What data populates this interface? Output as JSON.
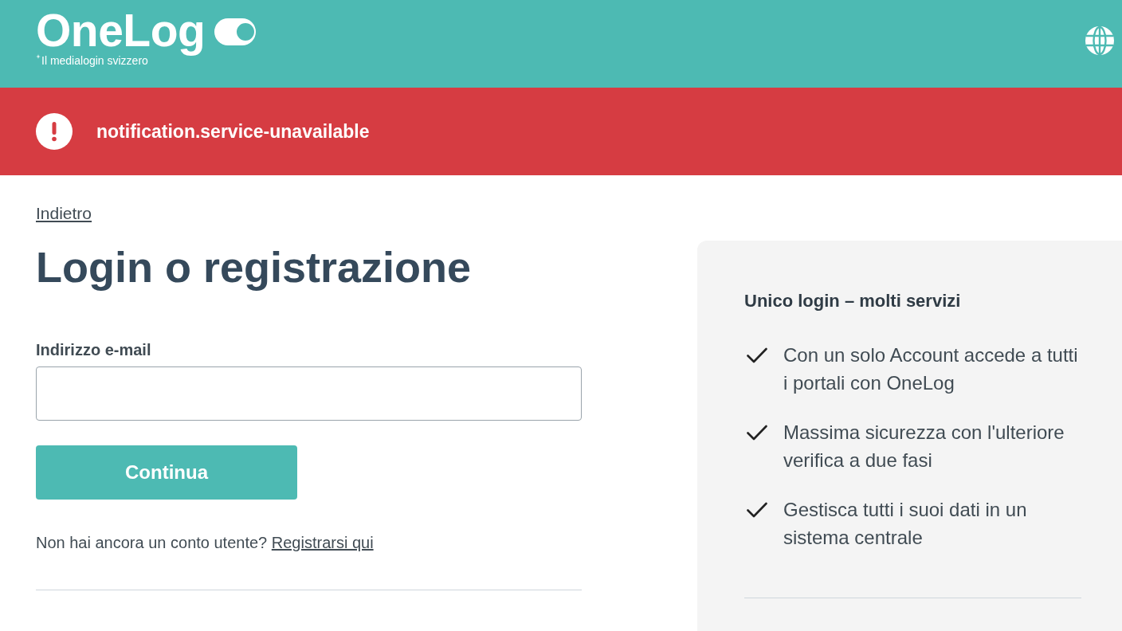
{
  "header": {
    "logo": {
      "name": "OneLog",
      "tagline": "Il medialogin svizzero"
    }
  },
  "notification": {
    "kind": "error",
    "message": "notification.service-unavailable"
  },
  "back_link": "Indietro",
  "title": "Login o registrazione",
  "email_field": {
    "label": "Indirizzo e-mail"
  },
  "continue_button": "Continua",
  "signup": {
    "text": "Non hai ancora un conto utente?",
    "link": "Registrarsi qui"
  },
  "benefits": {
    "title": "Unico login – molti servizi",
    "items": [
      "Con un solo Account accede a tutti i portali con OneLog",
      "Massima sicurezza con l'ulteriore verifica a due fasi",
      "Gestisca tutti i suoi dati in un sistema centrale"
    ]
  }
}
